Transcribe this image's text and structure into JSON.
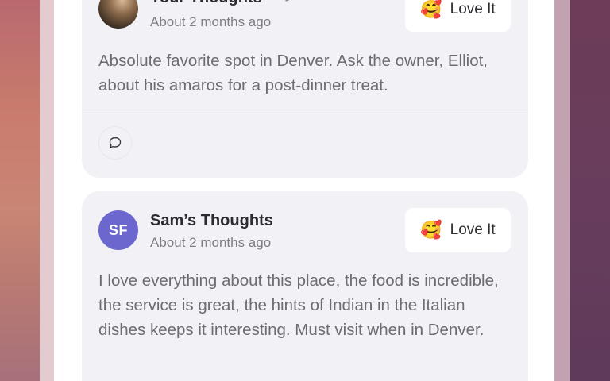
{
  "reviews": [
    {
      "author": "Your Thoughts",
      "timestamp": "About 2 months ago",
      "reaction": {
        "emoji": "🥰",
        "label": "Love It"
      },
      "text": "Absolute favorite spot in Denver. Ask the owner, Elliot, about his amaros for a post-dinner treat.",
      "editable": true,
      "icons": {
        "avatar": "user-photo",
        "edit": "pencil-icon",
        "comment": "comment-bubble-icon"
      }
    },
    {
      "author": "Sam’s Thoughts",
      "timestamp": "About 2 months ago",
      "initials": "SF",
      "reaction": {
        "emoji": "🥰",
        "label": "Love It"
      },
      "text": "I love everything about this place, the food is incredible, the service is great, the hints of Indian in the Italian dishes keeps it interesting. Must visit when in Denver."
    }
  ],
  "colors": {
    "card_background": "#f2f2f6",
    "avatar_initials_background": "#6b67cf",
    "primary_text": "#2c2c30",
    "secondary_text": "#7d7d85"
  }
}
